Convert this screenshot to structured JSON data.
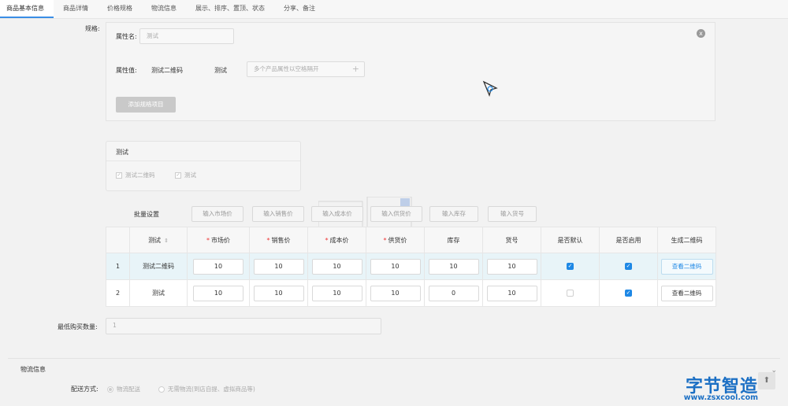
{
  "tabs": [
    "商品基本信息",
    "商品详情",
    "价格规格",
    "物流信息",
    "展示、排序、置顶、状态",
    "分享、备注"
  ],
  "spec": {
    "label": "规格:",
    "attr_name_label": "属性名:",
    "attr_name_value": "测试",
    "attr_value_label": "属性值:",
    "attr_value_1": "测试二维码",
    "attr_value_2": "测试",
    "attr_value_placeholder": "多个产品属性以空格隔开",
    "close": "x",
    "add_button": "添加规格项目"
  },
  "preview": {
    "title": "测试",
    "items": [
      "测试二维码",
      "测试"
    ]
  },
  "batch": {
    "label": "批量设置",
    "buttons": [
      "输入市场价",
      "输入销售价",
      "输入成本价",
      "输入供货价",
      "输入库存",
      "输入货号"
    ]
  },
  "table": {
    "headers": [
      "",
      "测试",
      "市场价",
      "销售价",
      "成本价",
      "供货价",
      "库存",
      "货号",
      "是否默认",
      "是否启用",
      "生成二维码"
    ],
    "required_mark": "*",
    "rows": [
      {
        "index": "1",
        "name": "测试二维码",
        "market": "10",
        "sale": "10",
        "cost": "10",
        "supply": "10",
        "stock": "10",
        "sku": "10",
        "is_default": true,
        "enabled": true,
        "qr_label": "查看二维码"
      },
      {
        "index": "2",
        "name": "测试",
        "market": "10",
        "sale": "10",
        "cost": "10",
        "supply": "10",
        "stock": "0",
        "sku": "10",
        "is_default": false,
        "enabled": true,
        "qr_label": "查看二维码"
      }
    ]
  },
  "min_buy": {
    "label": "最低购买数量:",
    "value": "1"
  },
  "logistics": {
    "section_title": "物流信息",
    "delivery_label": "配送方式:",
    "options": [
      "物流配送",
      "无需物流(到店自提、虚拟商品等)"
    ]
  },
  "watermark": {
    "logo": "字节智造",
    "url": "www.zsxcool.com"
  },
  "colors": {
    "accent": "#1e88e5",
    "row_highlight": "#e8f4f8",
    "watermark": "#1b6fc4"
  }
}
